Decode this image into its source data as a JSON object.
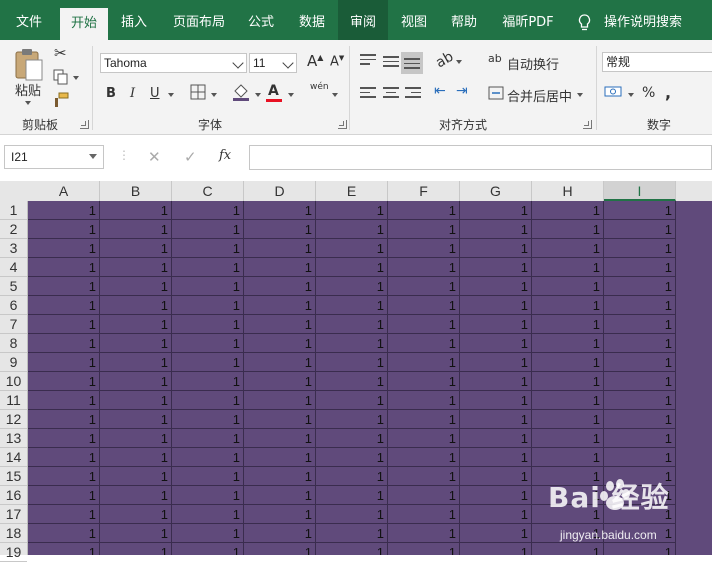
{
  "ribbon_tabs": [
    "文件",
    "开始",
    "插入",
    "页面布局",
    "公式",
    "数据",
    "审阅",
    "视图",
    "帮助",
    "福昕PDF"
  ],
  "tell_me": "操作说明搜索",
  "clipboard": {
    "paste_label": "粘贴",
    "group_label": "剪贴板"
  },
  "font": {
    "name": "Tahoma",
    "size": "11",
    "bold": "B",
    "italic": "I",
    "underline": "U",
    "phonetic": "wén",
    "group_label": "字体"
  },
  "alignment": {
    "wrap_text": "自动换行",
    "merge_center": "合并后居中",
    "group_label": "对齐方式"
  },
  "number": {
    "format": "常规",
    "percent": "%",
    "group_label": "数字"
  },
  "formula_bar": {
    "name_box": "I21",
    "cancel": "✕",
    "enter": "✓",
    "fx": "fx",
    "value": ""
  },
  "grid": {
    "columns": [
      "A",
      "B",
      "C",
      "D",
      "E",
      "F",
      "G",
      "H",
      "I"
    ],
    "selected_column": "I",
    "rows": [
      "1",
      "2",
      "3",
      "4",
      "5",
      "6",
      "7",
      "8",
      "9",
      "10",
      "11",
      "12",
      "13",
      "14",
      "15",
      "16",
      "17",
      "18",
      "19"
    ],
    "cell_value": "1",
    "fill_color": "#604a7b"
  },
  "colors": {
    "brand": "#217346",
    "font_color": "#e81123"
  },
  "watermark": {
    "logo": "Bai 经验",
    "url": "jingyan.baidu.com"
  }
}
